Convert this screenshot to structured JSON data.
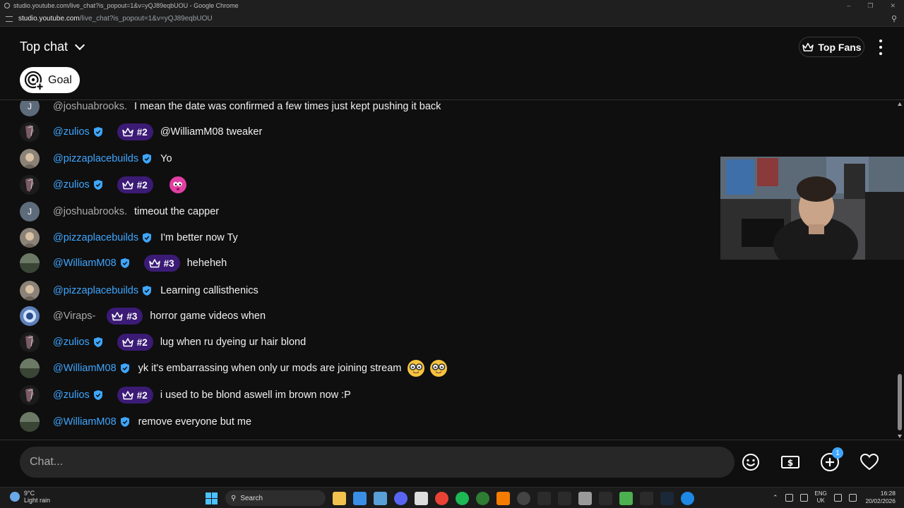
{
  "browser": {
    "title": "studio.youtube.com/live_chat?is_popout=1&v=yQJ89eqbUOU - Google Chrome",
    "url_host": "studio.youtube.com",
    "url_path": "/live_chat?is_popout=1&v=yQJ89eqbUOU"
  },
  "header": {
    "mode_label": "Top chat",
    "top_fans_label": "Top Fans",
    "goal_label": "Goal"
  },
  "messages": [
    {
      "author": "@joshuabrooks.",
      "verified": false,
      "badge": "",
      "text": "I mean the date was confirmed a few times just kept pushing it back",
      "avatar": "letter",
      "letter": "J",
      "emoji": 0
    },
    {
      "author": "@zulios",
      "verified": true,
      "badge": "#2",
      "text": "@WilliamM08 tweaker",
      "avatar": "dark",
      "letter": "",
      "emoji": 0
    },
    {
      "author": "@pizzaplacebuilds",
      "verified": true,
      "badge": "",
      "text": "Yo",
      "avatar": "face",
      "letter": "",
      "emoji": 0
    },
    {
      "author": "@zulios",
      "verified": true,
      "badge": "#2",
      "text": "",
      "avatar": "dark",
      "letter": "",
      "emoji": 1,
      "emoji_kind": "pink"
    },
    {
      "author": "@joshuabrooks.",
      "verified": false,
      "badge": "",
      "text": "timeout the capper",
      "avatar": "letter",
      "letter": "J",
      "emoji": 0
    },
    {
      "author": "@pizzaplacebuilds",
      "verified": true,
      "badge": "",
      "text": "I'm better now Ty",
      "avatar": "face",
      "letter": "",
      "emoji": 0
    },
    {
      "author": "@WilliamM08",
      "verified": true,
      "badge": "#3",
      "text": "heheheh",
      "avatar": "green",
      "letter": "",
      "emoji": 0
    },
    {
      "author": "@pizzaplacebuilds",
      "verified": true,
      "badge": "",
      "text": "Learning callisthenics",
      "avatar": "face",
      "letter": "",
      "emoji": 0
    },
    {
      "author": "@Viraps-",
      "verified": false,
      "badge": "#3",
      "text": "horror game videos when",
      "avatar": "blue",
      "letter": "",
      "emoji": 0
    },
    {
      "author": "@zulios",
      "verified": true,
      "badge": "#2",
      "text": "lug when ru dyeing ur hair blond",
      "avatar": "dark",
      "letter": "",
      "emoji": 0
    },
    {
      "author": "@WilliamM08",
      "verified": true,
      "badge": "",
      "text": "yk it's embarrassing when only ur mods are joining stream",
      "avatar": "green",
      "letter": "",
      "emoji": 2,
      "emoji_kind": "nerd"
    },
    {
      "author": "@zulios",
      "verified": true,
      "badge": "#2",
      "text": "i used to be blond aswell im brown now :P",
      "avatar": "dark",
      "letter": "",
      "emoji": 0
    },
    {
      "author": "@WilliamM08",
      "verified": true,
      "badge": "",
      "text": "remove everyone but me",
      "avatar": "green",
      "letter": "",
      "emoji": 0
    }
  ],
  "input": {
    "placeholder": "Chat...",
    "notification_count": "1"
  },
  "taskbar": {
    "temperature": "9°C",
    "weather": "Light rain",
    "search_label": "Search",
    "lang_top": "ENG",
    "lang_bottom": "UK",
    "time": "16:28",
    "date": "20/02/2026"
  },
  "colors": {
    "author_link": "#3ea6ff",
    "badge_bg": "#3b1b75",
    "background": "#0f0f0f",
    "input_bg": "#272727"
  }
}
